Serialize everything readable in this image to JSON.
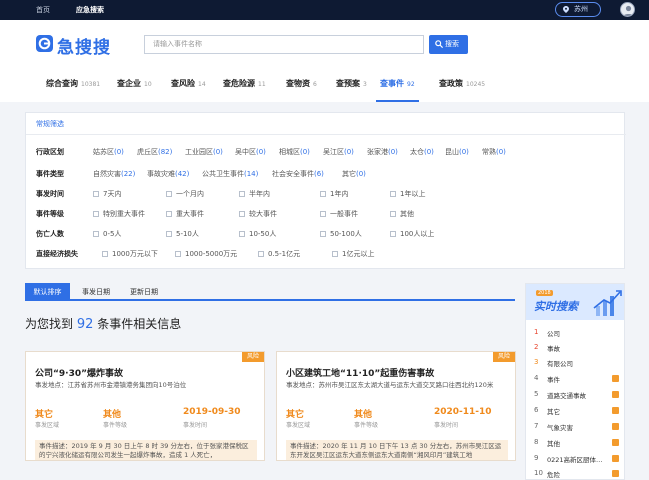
{
  "topbar": {
    "home": "首页",
    "emergency": "应急搜索",
    "city": "苏州"
  },
  "header": {
    "logo_text": "急搜搜",
    "search_placeholder": "请输入事件名称",
    "search_button": "搜索"
  },
  "tabs": [
    {
      "label": "综合查询",
      "count": "10381"
    },
    {
      "label": "查企业",
      "count": "10"
    },
    {
      "label": "查风险",
      "count": "14"
    },
    {
      "label": "查危险源",
      "count": "11"
    },
    {
      "label": "查物资",
      "count": "6"
    },
    {
      "label": "查预案",
      "count": "3"
    },
    {
      "label": "查事件",
      "count": "92"
    },
    {
      "label": "查政策",
      "count": "10245"
    }
  ],
  "filter": {
    "title": "常规筛选",
    "district": {
      "label": "行政区划",
      "options": [
        {
          "name": "姑苏区",
          "n": "(0)"
        },
        {
          "name": "虎丘区",
          "n": "(82)"
        },
        {
          "name": "工业园区",
          "n": "(0)"
        },
        {
          "name": "吴中区",
          "n": "(0)"
        },
        {
          "name": "相城区",
          "n": "(0)"
        },
        {
          "name": "吴江区",
          "n": "(0)"
        },
        {
          "name": "张家港",
          "n": "(0)"
        },
        {
          "name": "太仓",
          "n": "(0)"
        },
        {
          "name": "昆山",
          "n": "(0)"
        },
        {
          "name": "常熟",
          "n": "(0)"
        }
      ]
    },
    "event_type": {
      "label": "事件类型",
      "options": [
        {
          "name": "自然灾害",
          "n": "(22)"
        },
        {
          "name": "事故灾难",
          "n": "(42)"
        },
        {
          "name": "公共卫生事件",
          "n": "(14)"
        },
        {
          "name": "社会安全事件",
          "n": "(6)"
        },
        {
          "name": "其它",
          "n": "(0)"
        }
      ]
    },
    "event_time": {
      "label": "事发时间",
      "options": [
        "7天内",
        "一个月内",
        "半年内",
        "1年内",
        "1年以上"
      ]
    },
    "event_level": {
      "label": "事件等级",
      "options": [
        "特别重大事件",
        "重大事件",
        "较大事件",
        "一般事件",
        "其他"
      ]
    },
    "casualties": {
      "label": "伤亡人数",
      "options": [
        "0-5人",
        "5-10人",
        "10-50人",
        "50-100人",
        "100人以上"
      ]
    },
    "economic_loss": {
      "label": "直接经济损失",
      "options": [
        "1000万元以下",
        "1000-5000万元",
        "0.5-1亿元",
        "1亿元以上"
      ]
    }
  },
  "sort_tabs": [
    "默认排序",
    "事发日期",
    "更新日期"
  ],
  "result": {
    "prefix": "为您找到",
    "count": "92",
    "suffix": "条事件相关信息"
  },
  "cards": [
    {
      "badge": "风险",
      "title": "公司“9·30”爆炸事故",
      "address": "事发地点：江苏省苏州市金港镇港务集团向10号泊位",
      "stat1": "其它",
      "stat1_label": "事发区域",
      "stat2": "其他",
      "stat2_label": "事件等级",
      "date": "2019-09-30",
      "date_label": "事发时间",
      "desc": "事件描述：2019 年 9 月 30 日上午 8 时 39 分左右，位于张家港保税区的宁兴液化储运有限公司发生一起爆炸事故，造成 1 人死亡，"
    },
    {
      "badge": "风险",
      "title": "小区建筑工地“11·10”起重伤害事故",
      "address": "事发地点：苏州市吴江区东太湖大道与运东大道交叉路口往西北约120米",
      "stat1": "其它",
      "stat1_label": "事发区域",
      "stat2": "其他",
      "stat2_label": "事件等级",
      "date": "2020-11-10",
      "date_label": "事发时间",
      "desc": "事件描述：2020 年 11 月 10 日下午 13 点 30 分左右，苏州市吴江区运东开发区吴江区运东大道东侧运东大道南侧“湘风印月”建筑工地"
    }
  ],
  "side": {
    "tag": "2018",
    "title": "实时搜索",
    "items": [
      {
        "rank": "1",
        "text": "公司"
      },
      {
        "rank": "2",
        "text": "事故"
      },
      {
        "rank": "3",
        "text": "有限公司"
      },
      {
        "rank": "4",
        "text": "事件"
      },
      {
        "rank": "5",
        "text": "道路交通事故"
      },
      {
        "rank": "6",
        "text": "其它"
      },
      {
        "rank": "7",
        "text": "气象灾害"
      },
      {
        "rank": "8",
        "text": "其他"
      },
      {
        "rank": "9",
        "text": "0221高新区厨体…"
      },
      {
        "rank": "10",
        "text": "危险"
      }
    ]
  },
  "colors": {
    "accent": "#2f6fe5",
    "warning": "#f08a1c",
    "topbar": "#0e1a33"
  }
}
